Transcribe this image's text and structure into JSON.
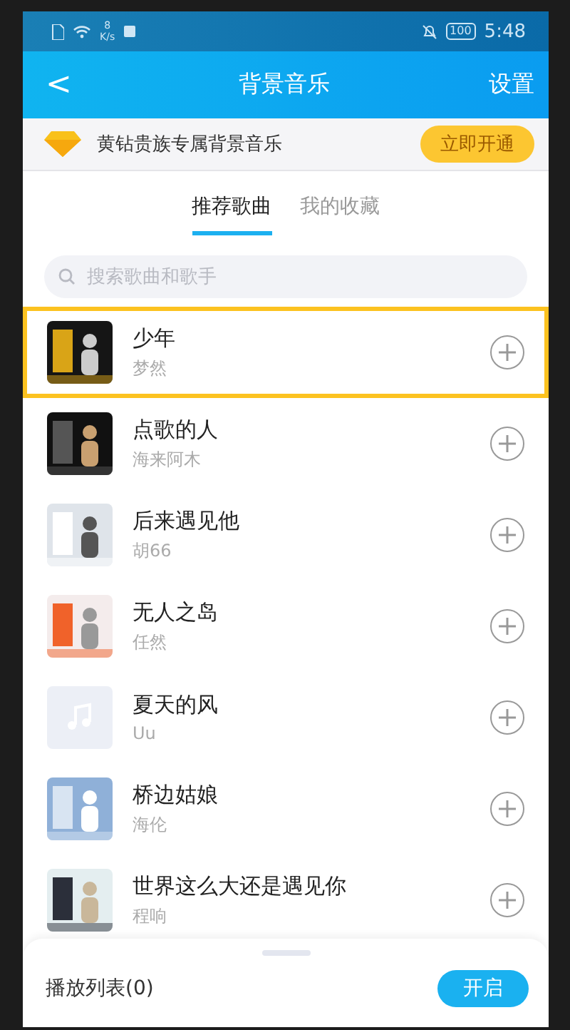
{
  "status_bar": {
    "net_speed_value": "8",
    "net_speed_unit": "K/s",
    "battery": "100",
    "time": "5:48"
  },
  "header": {
    "back": "<",
    "title": "背景音乐",
    "action": "设置"
  },
  "banner": {
    "text": "黄钻贵族专属背景音乐",
    "button": "立即开通"
  },
  "tabs": [
    {
      "label": "推荐歌曲",
      "selected": true
    },
    {
      "label": "我的收藏",
      "selected": false
    }
  ],
  "search": {
    "placeholder": "搜索歌曲和歌手"
  },
  "songs": [
    {
      "title": "少年",
      "artist": "梦然",
      "kind": "picture",
      "highlighted": true
    },
    {
      "title": "点歌的人",
      "artist": "海来阿木",
      "kind": "picture",
      "highlighted": false
    },
    {
      "title": "后来遇见他",
      "artist": "胡66",
      "kind": "picture",
      "highlighted": false
    },
    {
      "title": "无人之岛",
      "artist": "任然",
      "kind": "picture",
      "highlighted": false
    },
    {
      "title": "夏天的风",
      "artist": "Uu",
      "kind": "placeholder",
      "highlighted": false
    },
    {
      "title": "桥边姑娘",
      "artist": "海伦",
      "kind": "picture",
      "highlighted": false
    },
    {
      "title": "世界这么大还是遇见你",
      "artist": "程响",
      "kind": "picture",
      "highlighted": false
    }
  ],
  "playlist": {
    "label": "播放列表(0)",
    "button": "开启"
  }
}
